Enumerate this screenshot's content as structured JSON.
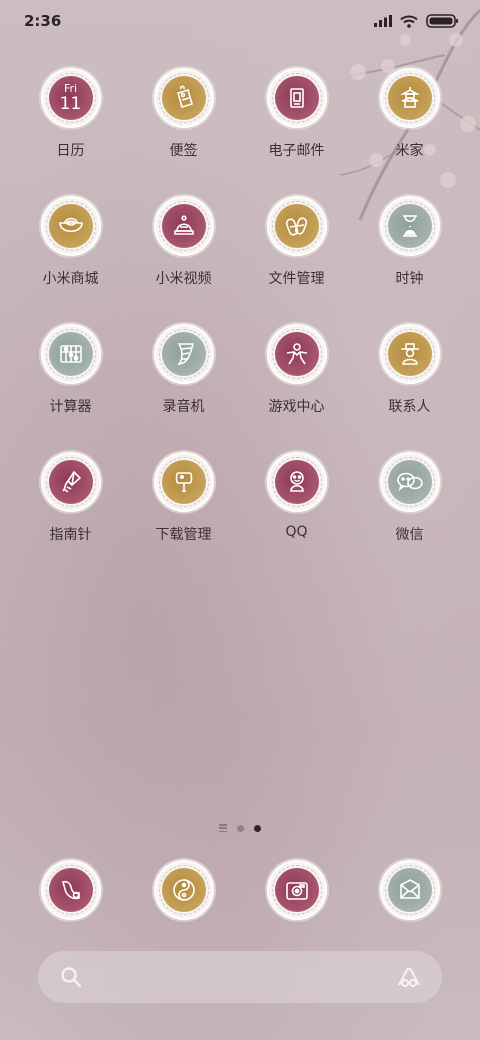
{
  "status_bar": {
    "time": "2:36",
    "icons": [
      "signal-icon",
      "wifi-icon",
      "battery-icon"
    ]
  },
  "apps": [
    {
      "label": "日历",
      "icon": "calendar-icon",
      "tone": "wine",
      "calendar": {
        "day": "Fri",
        "date": "11"
      }
    },
    {
      "label": "便签",
      "icon": "note-tag-icon",
      "tone": "gold"
    },
    {
      "label": "电子邮件",
      "icon": "mail-scroll-icon",
      "tone": "wine"
    },
    {
      "label": "米家",
      "icon": "pagoda-icon",
      "tone": "gold"
    },
    {
      "label": "小米商城",
      "icon": "gold-ingot-icon",
      "tone": "gold"
    },
    {
      "label": "小米视频",
      "icon": "bell-hat-icon",
      "tone": "wine"
    },
    {
      "label": "文件管理",
      "icon": "scroll-bundle-icon",
      "tone": "gold"
    },
    {
      "label": "时钟",
      "icon": "hourglass-icon",
      "tone": "sage"
    },
    {
      "label": "计算器",
      "icon": "abacus-icon",
      "tone": "sage"
    },
    {
      "label": "录音机",
      "icon": "horn-icon",
      "tone": "sage"
    },
    {
      "label": "游戏中心",
      "icon": "figure-icon",
      "tone": "wine"
    },
    {
      "label": "联系人",
      "icon": "scholar-icon",
      "tone": "gold"
    },
    {
      "label": "指南针",
      "icon": "kite-icon",
      "tone": "wine"
    },
    {
      "label": "下载管理",
      "icon": "fan-icon",
      "tone": "gold"
    },
    {
      "label": "QQ",
      "icon": "doll-icon",
      "tone": "wine"
    },
    {
      "label": "微信",
      "icon": "chat-bubbles-icon",
      "tone": "sage"
    }
  ],
  "page_indicator": {
    "pages": 2,
    "active_page": 2
  },
  "dock": [
    {
      "icon": "phone-horn-icon",
      "tone": "wine"
    },
    {
      "icon": "yin-yang-icon",
      "tone": "gold"
    },
    {
      "icon": "camera-icon",
      "tone": "wine"
    },
    {
      "icon": "envelope-icon",
      "tone": "sage"
    }
  ],
  "search_bar": {
    "left_icon": "search-icon",
    "right_icon": "assistant-icon"
  },
  "colors": {
    "wine": "#9b4662",
    "gold": "#bf9a4f",
    "sage": "#9cabA8"
  }
}
